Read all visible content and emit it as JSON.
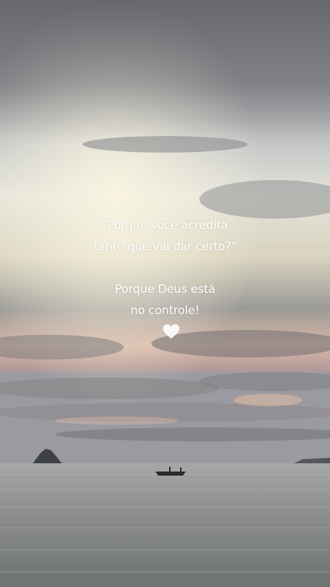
{
  "quote": {
    "question_line1": "\"Porque você acredita",
    "question_line2": "tanto que vai dar certo?\"",
    "answer_line1": "Porque Deus está",
    "answer_line2": "no controle!"
  },
  "icons": {
    "heart": "white-heart-icon"
  },
  "colors": {
    "sky_top": "#7b7d82",
    "sky_glow": "#f2e9cf",
    "horizon": "#e6b9a6",
    "sea": "#8d9190",
    "text": "#ffffff"
  }
}
